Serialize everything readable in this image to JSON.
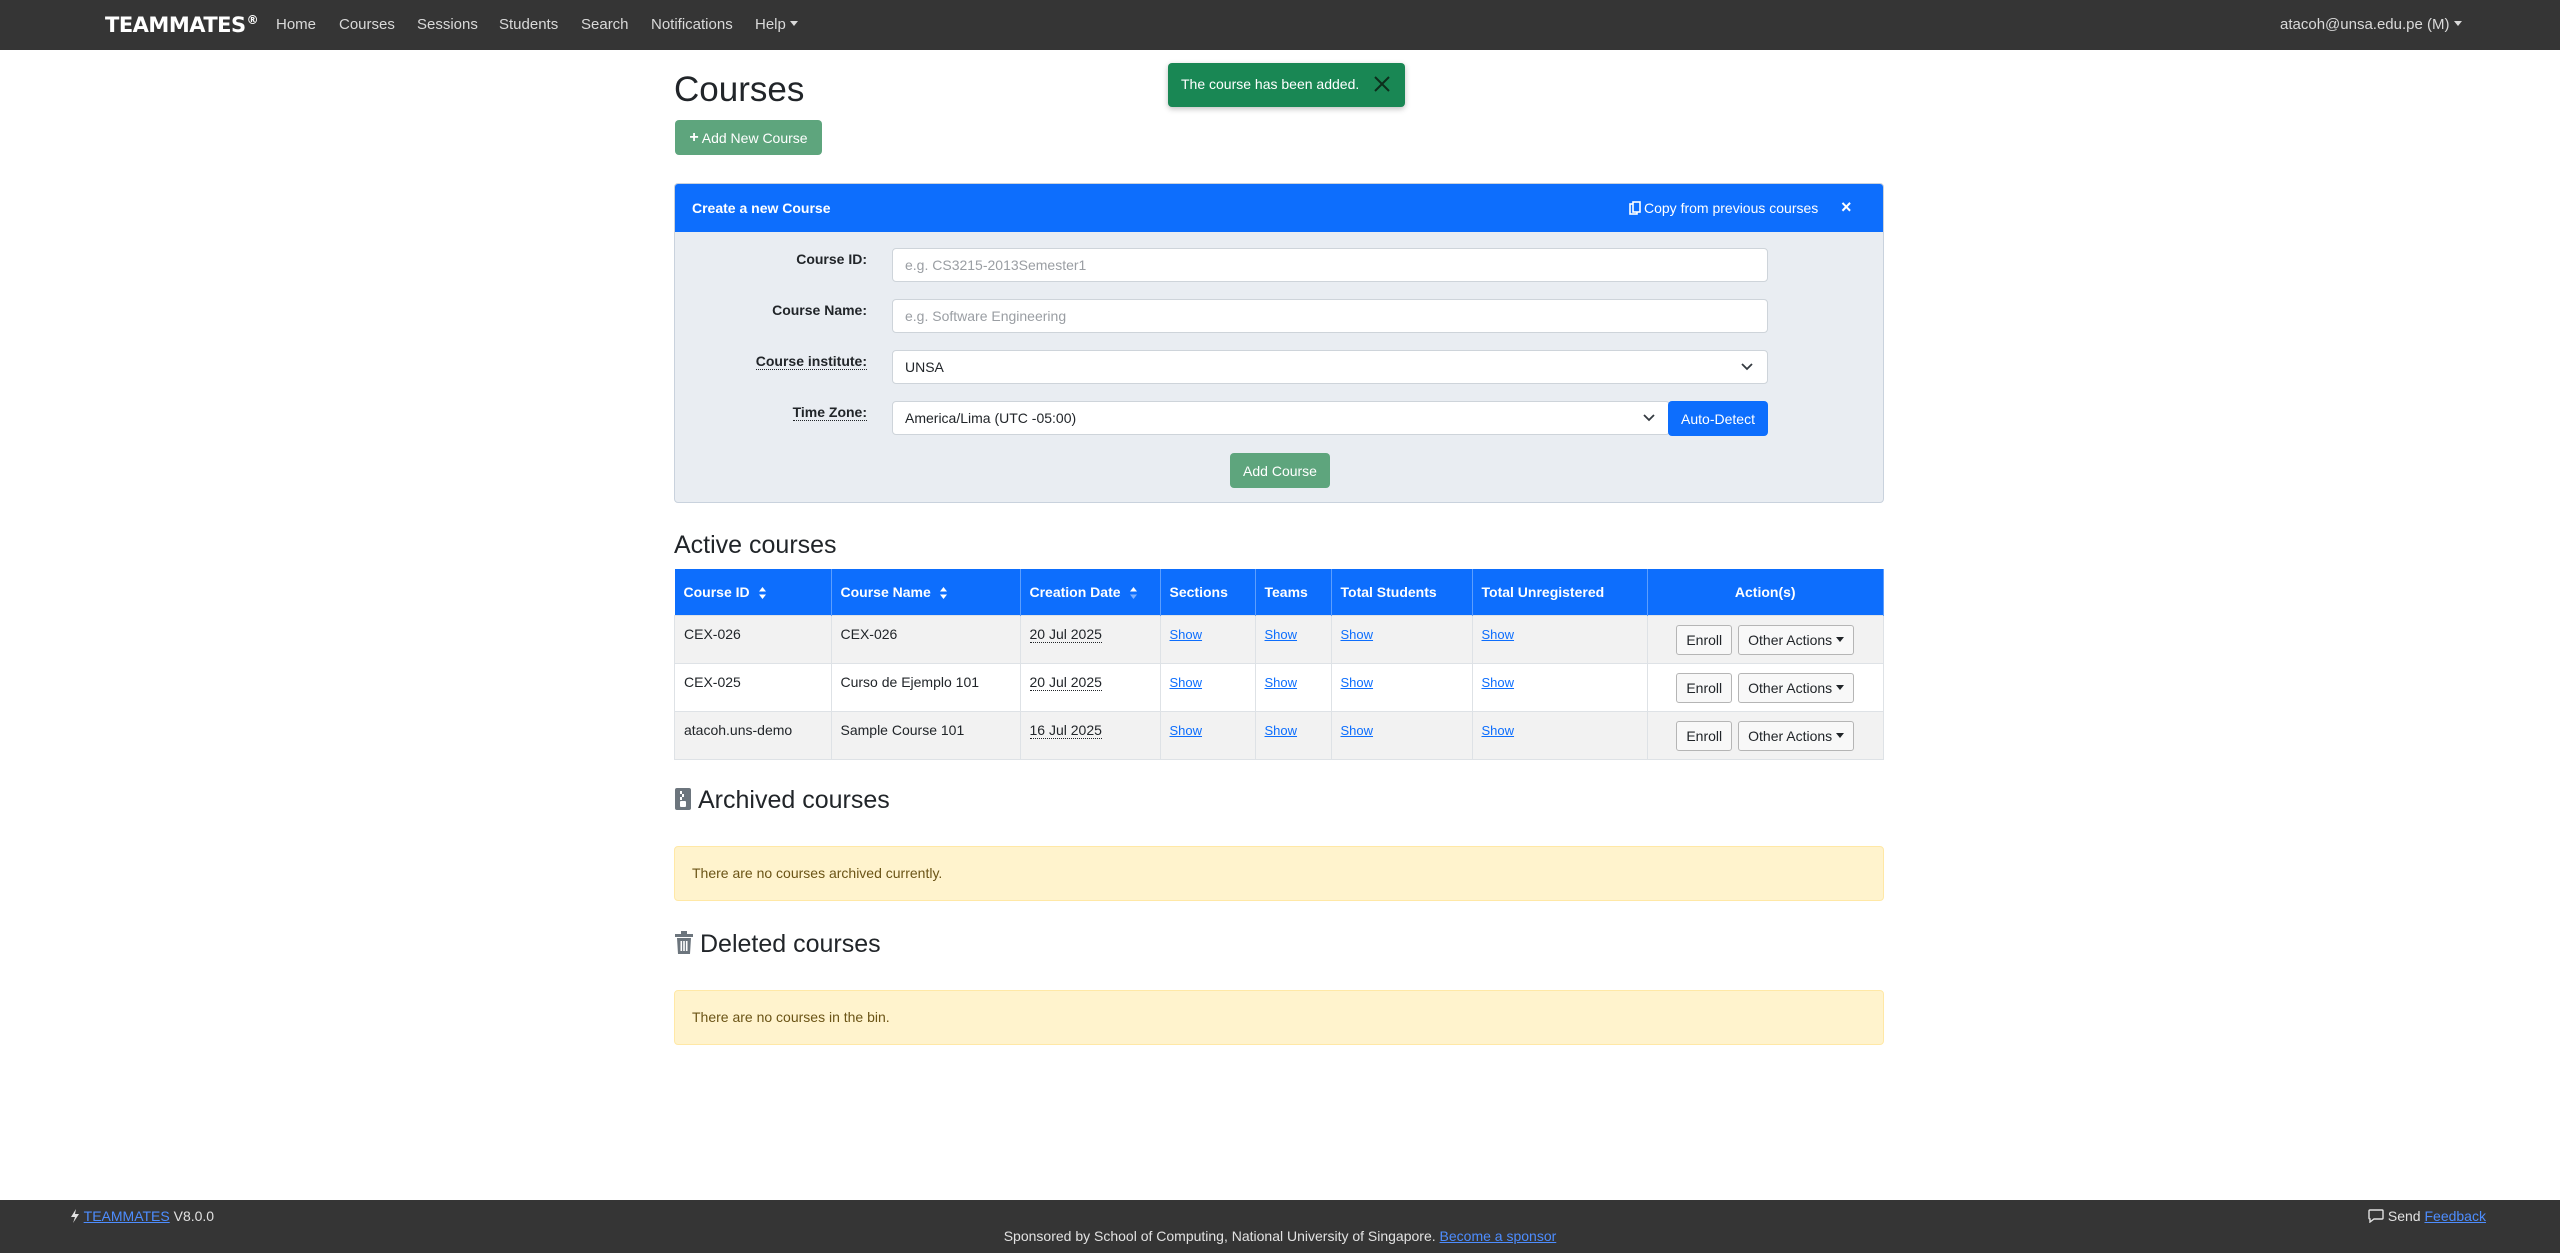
{
  "nav": {
    "brand": "TEAMMATES",
    "brand_sup": "®",
    "items": [
      "Home",
      "Courses",
      "Sessions",
      "Students",
      "Search",
      "Notifications"
    ],
    "help": "Help",
    "user": "atacoh@unsa.edu.pe (M)"
  },
  "toast": {
    "message": "The course has been added."
  },
  "page": {
    "title": "Courses",
    "add_new_label": "Add New Course"
  },
  "create_panel": {
    "title": "Create a new Course",
    "copy_label": "Copy from previous courses",
    "close": "×",
    "course_id_label": "Course ID:",
    "course_id_placeholder": "e.g. CS3215-2013Semester1",
    "course_name_label": "Course Name:",
    "course_name_placeholder": "e.g. Software Engineering",
    "institute_label": "Course institute:",
    "institute_value": "UNSA",
    "timezone_label": "Time Zone:",
    "timezone_value": "America/Lima (UTC -05:00)",
    "auto_detect_label": "Auto-Detect",
    "add_course_label": "Add Course"
  },
  "active": {
    "title": "Active courses",
    "headers": [
      "Course ID",
      "Course Name",
      "Creation Date",
      "Sections",
      "Teams",
      "Total Students",
      "Total Unregistered",
      "Action(s)"
    ],
    "rows": [
      {
        "id": "CEX-026",
        "name": "CEX-026",
        "date": "20 Jul 2025",
        "sections": "Show",
        "teams": "Show",
        "students": "Show",
        "unregistered": "Show",
        "enroll": "Enroll",
        "other": "Other Actions"
      },
      {
        "id": "CEX-025",
        "name": "Curso de Ejemplo 101",
        "date": "20 Jul 2025",
        "sections": "Show",
        "teams": "Show",
        "students": "Show",
        "unregistered": "Show",
        "enroll": "Enroll",
        "other": "Other Actions"
      },
      {
        "id": "atacoh.uns-demo",
        "name": "Sample Course 101",
        "date": "16 Jul 2025",
        "sections": "Show",
        "teams": "Show",
        "students": "Show",
        "unregistered": "Show",
        "enroll": "Enroll",
        "other": "Other Actions"
      }
    ]
  },
  "archived": {
    "title": "Archived courses",
    "message": "There are no courses archived currently."
  },
  "deleted": {
    "title": "Deleted courses",
    "message": "There are no courses in the bin."
  },
  "footer": {
    "brand_link": "TEAMMATES",
    "version": "V8.0.0",
    "send": "Send",
    "feedback": "Feedback",
    "sponsor_text": "Sponsored by School of Computing, National University of Singapore.",
    "sponsor_link": "Become a sponsor"
  },
  "colors": {
    "primary": "#0d6efd",
    "success": "#198754",
    "navbar": "#353535",
    "warning_bg": "#fff3cd"
  }
}
